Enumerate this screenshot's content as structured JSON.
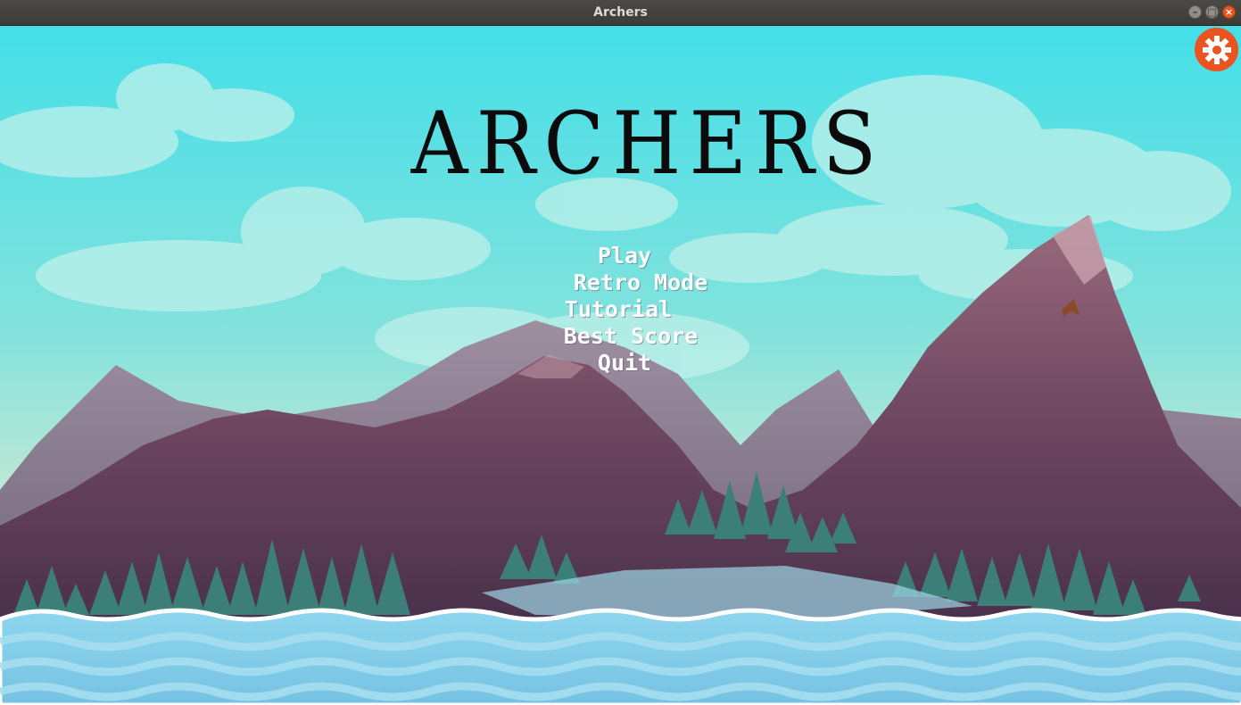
{
  "window": {
    "title": "Archers",
    "controls": {
      "minimize_icon": "minimize-icon",
      "maximize_icon": "maximize-icon",
      "close_icon": "close-icon"
    }
  },
  "game": {
    "title": "ARCHERS",
    "menu": {
      "play": "Play",
      "retro_mode": "Retro Mode",
      "tutorial": "Tutorial",
      "best_score": "Best Score",
      "quit": "Quit"
    },
    "settings_icon": "gear-icon"
  },
  "colors": {
    "sky_top": "#43dfe8",
    "sky_bottom": "#e4ebcd",
    "mountain": "#7a4f67",
    "trees": "#3c7f78",
    "water": "#86cfe8",
    "accent": "#e95420"
  }
}
